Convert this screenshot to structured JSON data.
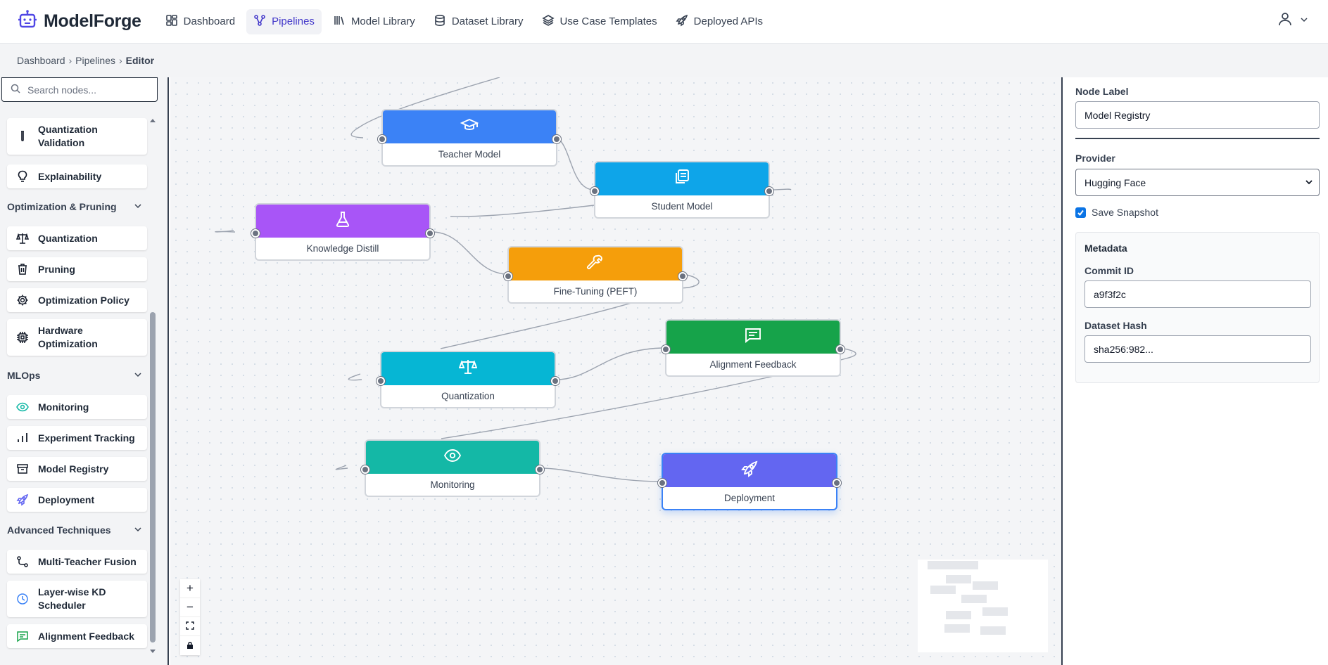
{
  "app": {
    "name": "ModelForge",
    "nav": [
      {
        "label": "Dashboard",
        "icon": "dashboard-icon",
        "active": false
      },
      {
        "label": "Pipelines",
        "icon": "pipelines-icon",
        "active": true
      },
      {
        "label": "Model Library",
        "icon": "library-icon",
        "active": false
      },
      {
        "label": "Dataset Library",
        "icon": "database-icon",
        "active": false
      },
      {
        "label": "Use Case Templates",
        "icon": "layers-icon",
        "active": false
      },
      {
        "label": "Deployed APIs",
        "icon": "rocket-icon",
        "active": false
      }
    ]
  },
  "breadcrumb": [
    "Dashboard",
    "Pipelines",
    "Editor"
  ],
  "palette": {
    "search_placeholder": "Search nodes...",
    "items": [
      {
        "label": "Quantization Validation",
        "icon": "test-tube-icon"
      },
      {
        "label": "Explainability",
        "icon": "lightbulb-icon"
      },
      {
        "label": "Quantization",
        "icon": "scale-icon"
      },
      {
        "label": "Pruning",
        "icon": "trash-icon"
      },
      {
        "label": "Optimization Policy",
        "icon": "gear-icon"
      },
      {
        "label": "Hardware Optimization",
        "icon": "chip-icon"
      },
      {
        "label": "Monitoring",
        "icon": "eye-icon"
      },
      {
        "label": "Experiment Tracking",
        "icon": "bar-chart-icon"
      },
      {
        "label": "Model Registry",
        "icon": "archive-icon"
      },
      {
        "label": "Deployment",
        "icon": "rocket-icon"
      },
      {
        "label": "Multi-Teacher Fusion",
        "icon": "route-icon"
      },
      {
        "label": "Layer-wise KD Scheduler",
        "icon": "clock-icon"
      },
      {
        "label": "Alignment Feedback",
        "icon": "message-icon"
      }
    ],
    "groups": [
      "Optimization & Pruning",
      "MLOps",
      "Advanced Techniques"
    ]
  },
  "canvas": {
    "nodes": [
      {
        "label": "Teacher Model",
        "color": "#3b82f6",
        "icon": "graduation-cap-icon"
      },
      {
        "label": "Student Model",
        "color": "#0ea5e9",
        "icon": "copy-icon"
      },
      {
        "label": "Knowledge Distill",
        "color": "#a855f7",
        "icon": "flask-icon"
      },
      {
        "label": "Fine-Tuning (PEFT)",
        "color": "#f59e0b",
        "icon": "wrench-icon"
      },
      {
        "label": "Quantization",
        "color": "#06b6d4",
        "icon": "scale-icon"
      },
      {
        "label": "Alignment Feedback",
        "color": "#16a34a",
        "icon": "message-icon"
      },
      {
        "label": "Monitoring",
        "color": "#14b8a6",
        "icon": "eye-icon"
      },
      {
        "label": "Deployment",
        "color": "#6366f1",
        "icon": "rocket-icon"
      }
    ],
    "zoom_controls": [
      "+",
      "−"
    ]
  },
  "properties": {
    "node_label_title": "Node Label",
    "node_label_value": "Model Registry",
    "provider_title": "Provider",
    "provider_value": "Hugging Face",
    "save_snapshot_label": "Save Snapshot",
    "save_snapshot_checked": true,
    "metadata_title": "Metadata",
    "commit_id_title": "Commit ID",
    "commit_id_value": "a9f3f2c",
    "dataset_hash_title": "Dataset Hash",
    "dataset_hash_value": "sha256:982..."
  }
}
